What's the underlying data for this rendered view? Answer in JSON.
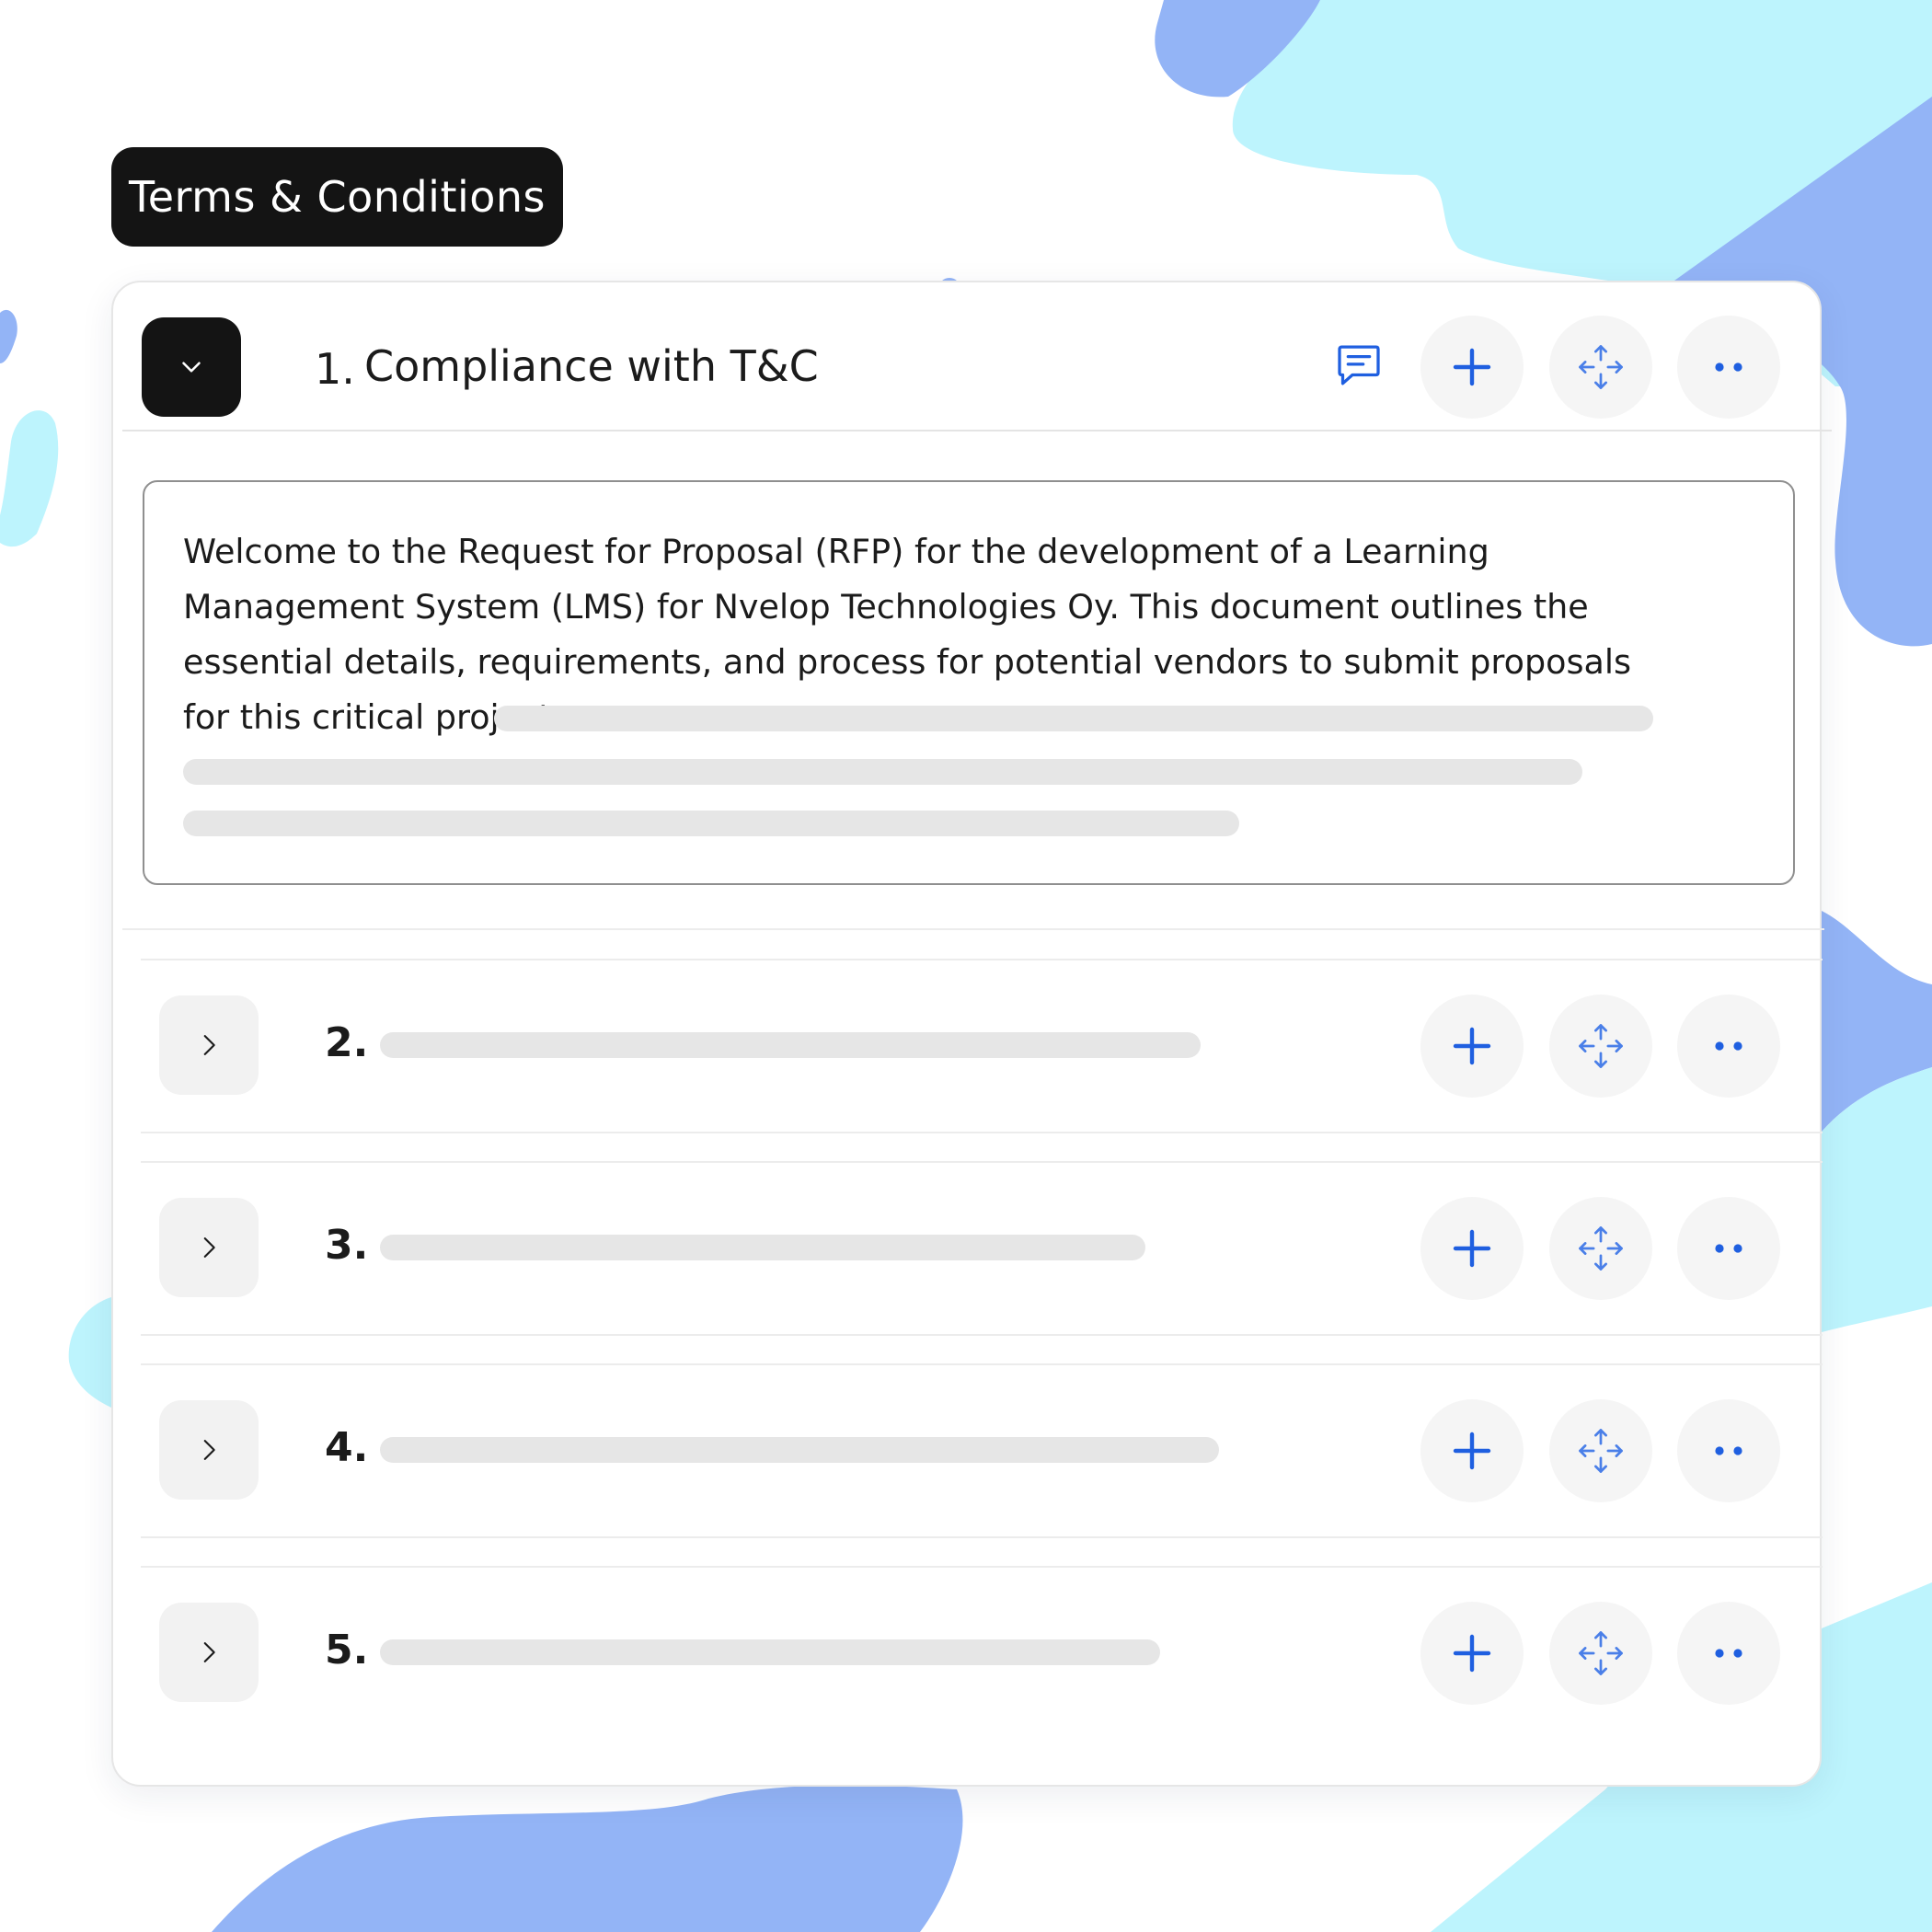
{
  "header": {
    "title": "Terms & Conditions"
  },
  "expanded_section": {
    "number": "1.",
    "title": "Compliance with T&C",
    "body": "Welcome to the Request for Proposal (RFP) for the development of a Learning Management System (LMS) for Nvelop Technologies Oy. This document outlines the essential details, requirements, and process for potential vendors to submit proposals for this critical project.",
    "icons": [
      "chevron-down-icon",
      "comment-icon",
      "plus-icon",
      "move-icon",
      "more-icon"
    ]
  },
  "collapsed_sections": [
    {
      "number": "2."
    },
    {
      "number": "3."
    },
    {
      "number": "4."
    },
    {
      "number": "5."
    }
  ],
  "colors": {
    "accent_blue": "#1f5fe0",
    "dark": "#141414",
    "blob_blue": "#93b4f6",
    "blob_cyan": "#bdf4fd"
  }
}
